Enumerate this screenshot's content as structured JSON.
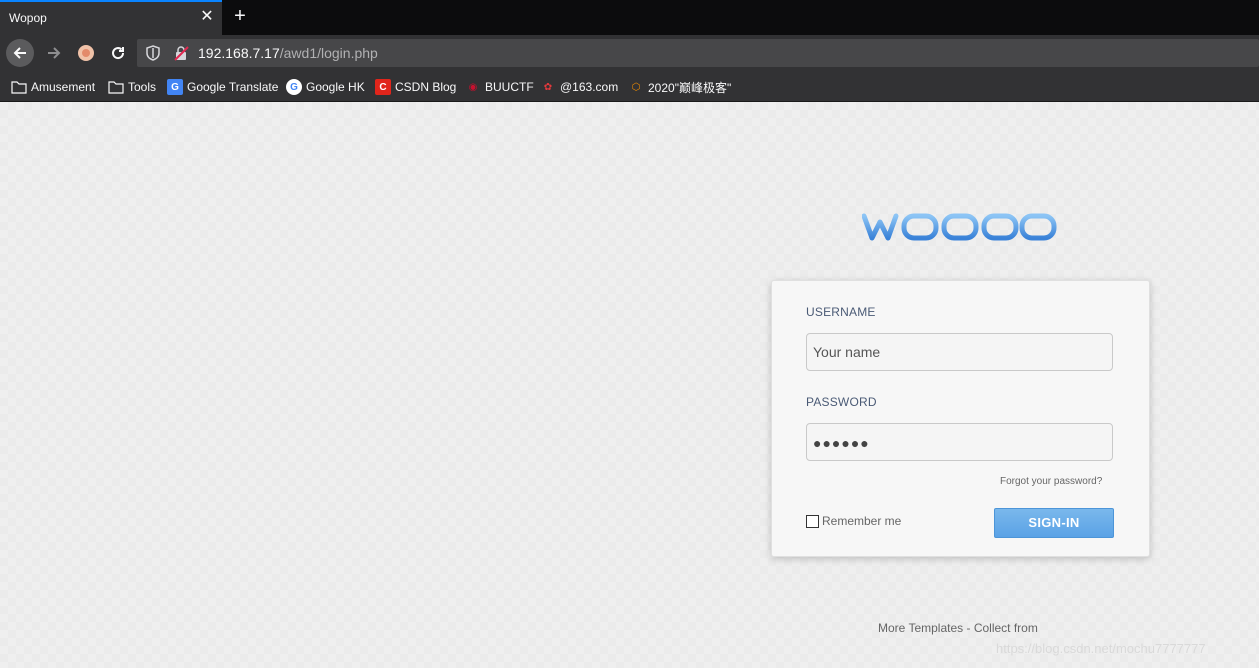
{
  "browser": {
    "tab_title": "Wopop",
    "tab_close": "✕",
    "new_tab": "+",
    "url_host": "192.168.7.17",
    "url_path": "/awd1/login.php"
  },
  "bookmarks": [
    {
      "label": "Amusement",
      "icon": "folder-icon"
    },
    {
      "label": "Tools",
      "icon": "folder-icon"
    },
    {
      "label": "Google Translate",
      "icon": "google-translate-icon"
    },
    {
      "label": "Google HK",
      "icon": "google-icon"
    },
    {
      "label": "CSDN Blog",
      "icon": "csdn-icon"
    },
    {
      "label": "BUUCTF",
      "icon": "buuctf-icon"
    },
    {
      "label": "@163.com",
      "icon": "netease-icon"
    },
    {
      "label": "2020\"巅峰极客\"",
      "icon": "geek-icon"
    }
  ],
  "page": {
    "logo_text": "wopop",
    "username_label": "USERNAME",
    "username_placeholder": "Your name",
    "password_label": "PASSWORD",
    "password_value": "●●●●●●",
    "forgot_link": "Forgot your password?",
    "remember_label": "Remember me",
    "signin_button": "SIGN-IN",
    "footer_text": "More Templates - Collect from",
    "watermark": "https://blog.csdn.net/mochu7777777"
  },
  "colors": {
    "accent_blue": "#5aa2e6",
    "tab_highlight": "#0a84ff",
    "chrome_dark": "#323234"
  }
}
